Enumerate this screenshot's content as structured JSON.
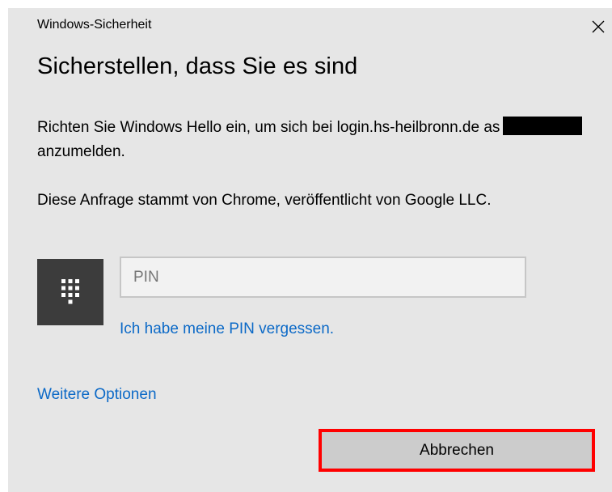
{
  "window": {
    "app_title": "Windows-Sicherheit",
    "close_icon": "close-icon"
  },
  "dialog": {
    "heading": "Sicherstellen, dass Sie es sind",
    "message": {
      "part1": "Richten Sie Windows Hello ein, um sich bei login.hs-heilbronn.de as",
      "part2": "anzumelden."
    },
    "origin_text": "Diese Anfrage stammt von Chrome, veröffentlicht von Google LLC.",
    "pin": {
      "tile_icon": "pin-keypad-icon",
      "placeholder": "PIN",
      "value": ""
    },
    "forgot_pin_link": "Ich habe meine PIN vergessen.",
    "more_options_link": "Weitere Optionen",
    "cancel_button": "Abbrechen"
  },
  "colors": {
    "dialog_background": "#e6e6e6",
    "link": "#0b69c7",
    "pin_tile": "#3c3c3c",
    "button_background": "#cccccc",
    "highlight_border": "#ff0000"
  }
}
